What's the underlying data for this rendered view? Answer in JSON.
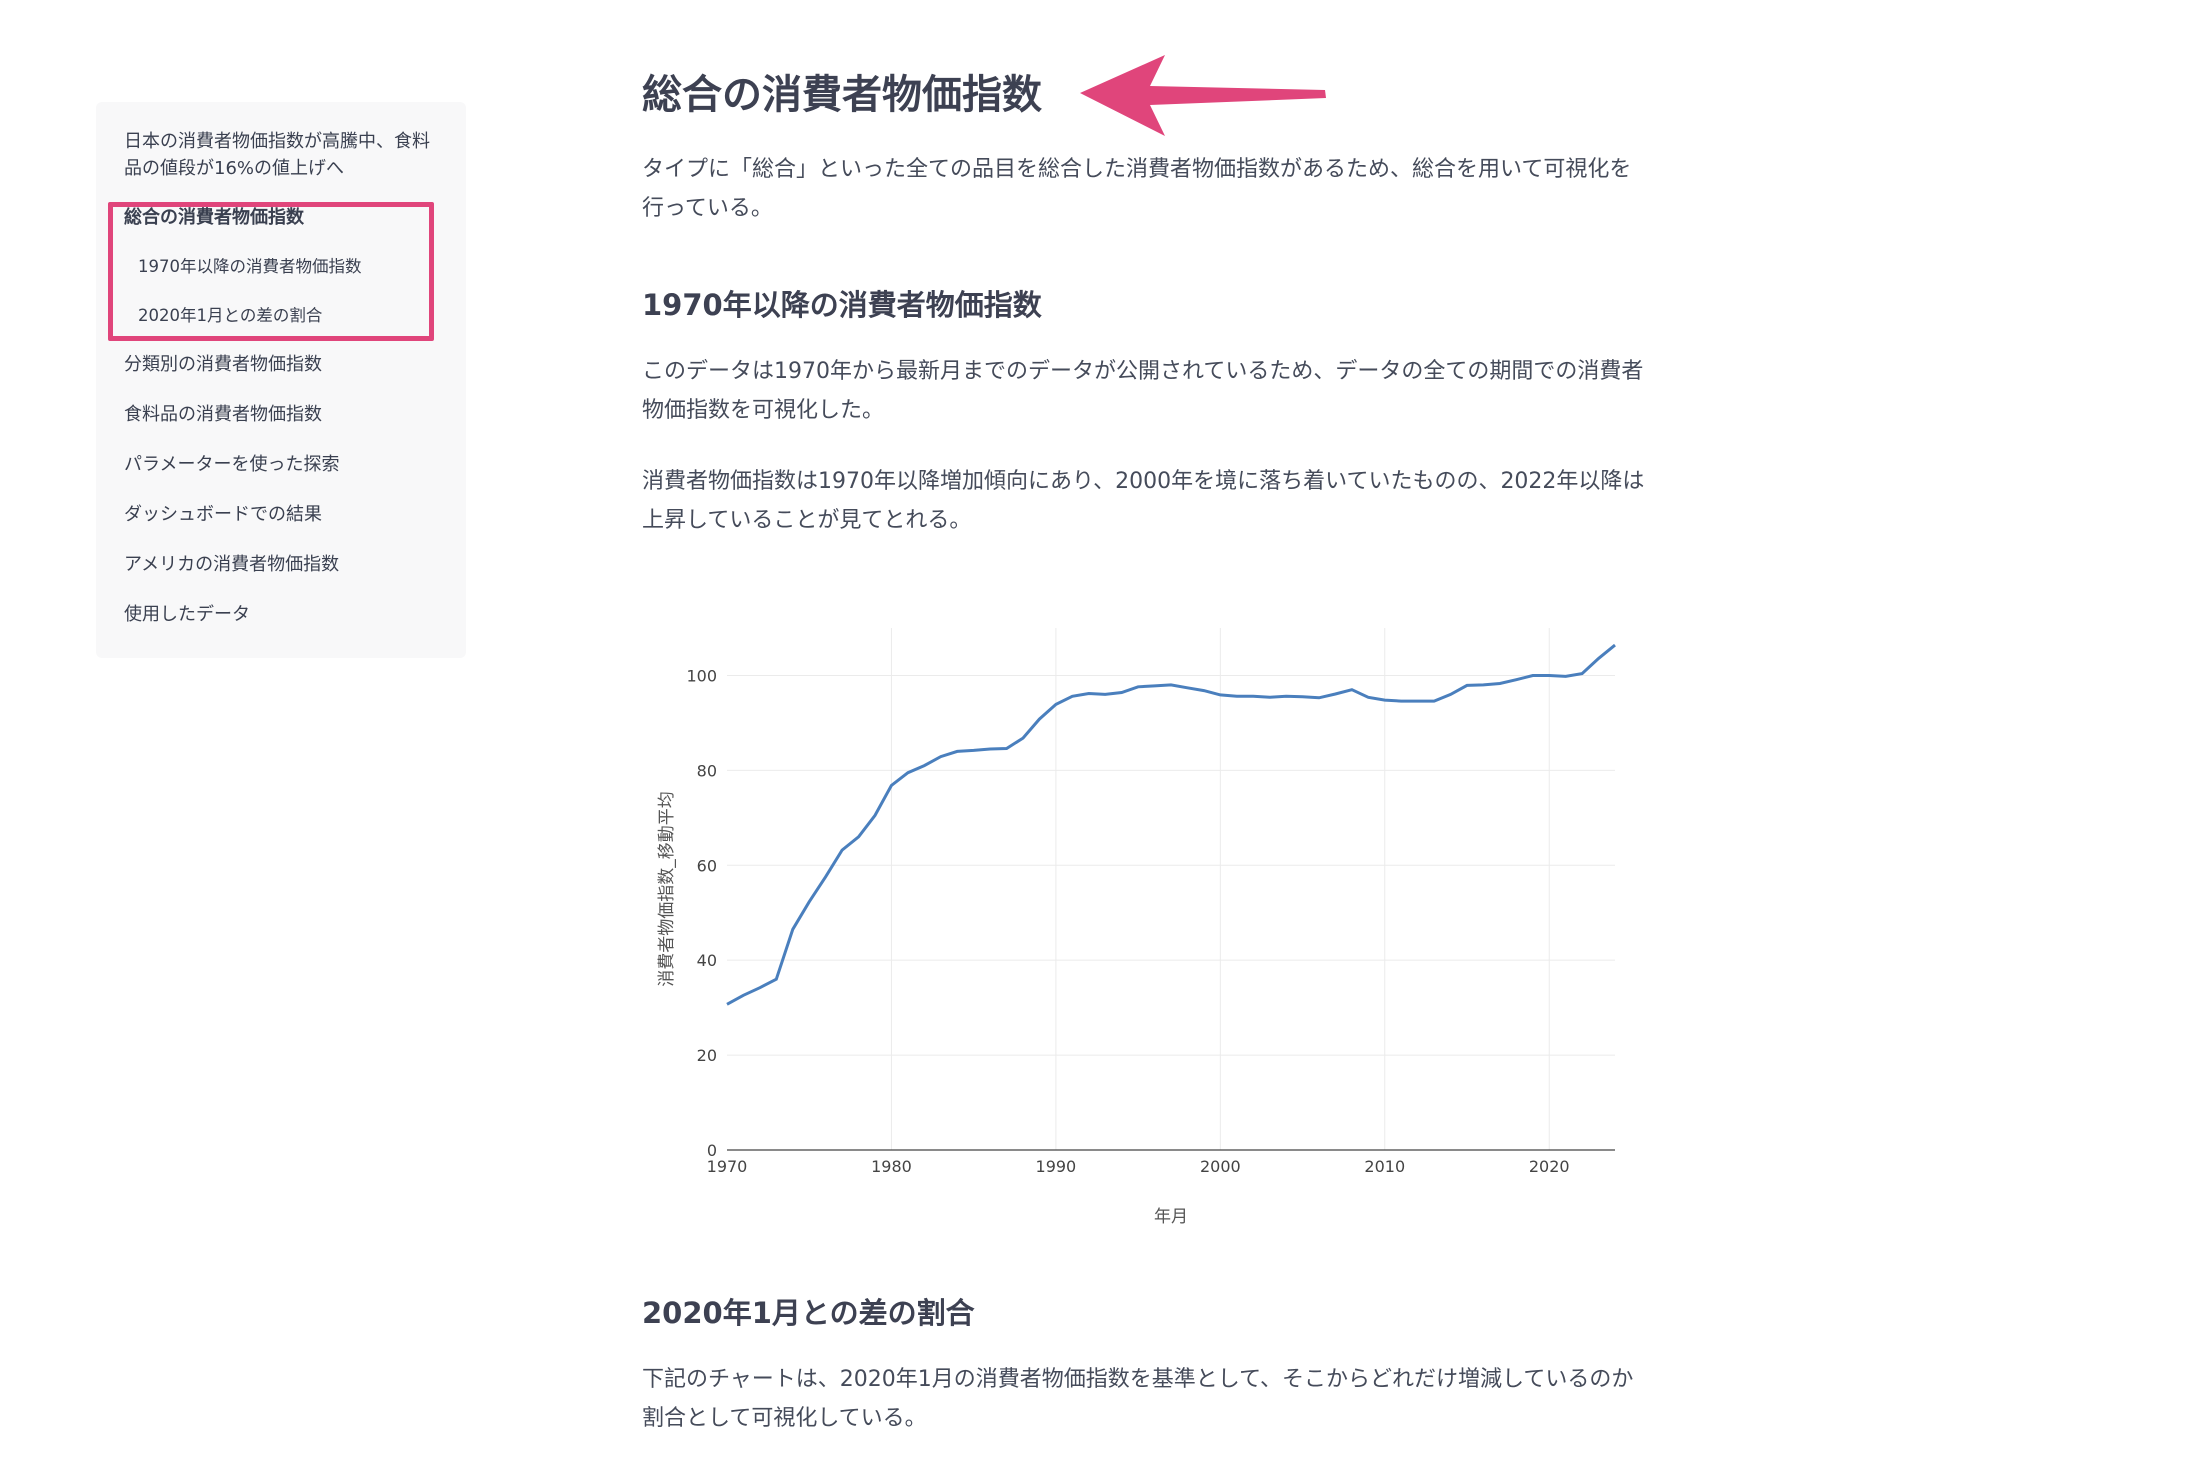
{
  "sidebar": {
    "items": [
      {
        "label": "日本の消費者物価指数が高騰中、食料品の値段が16%の値上げへ"
      },
      {
        "label": "総合の消費者物価指数"
      },
      {
        "label": "1970年以降の消費者物価指数"
      },
      {
        "label": "2020年1月との差の割合"
      },
      {
        "label": "分類別の消費者物価指数"
      },
      {
        "label": "食料品の消費者物価指数"
      },
      {
        "label": "パラメーターを使った探索"
      },
      {
        "label": "ダッシュボードでの結果"
      },
      {
        "label": "アメリカの消費者物価指数"
      },
      {
        "label": "使用したデータ"
      }
    ],
    "active_item": "総合の消費者物価指数"
  },
  "highlight_color": "#e0457b",
  "article": {
    "title": "総合の消費者物価指数",
    "intro": "タイプに「総合」といった全ての品目を総合した消費者物価指数があるため、総合を用いて可視化を行っている。",
    "section1": {
      "heading": "1970年以降の消費者物価指数",
      "p1": "このデータは1970年から最新月までのデータが公開されているため、データの全ての期間での消費者物価指数を可視化した。",
      "p2": "消費者物価指数は1970年以降増加傾向にあり、2000年を境に落ち着いていたものの、2022年以降は上昇していることが見てとれる。"
    },
    "section2": {
      "heading": "2020年1月との差の割合",
      "p1": "下記のチャートは、2020年1月の消費者物価指数を基準として、そこからどれだけ増減しているのか割合として可視化している。"
    }
  },
  "chart_data": {
    "type": "line",
    "xlabel": "年月",
    "ylabel": "消費者物価指数_移動平均",
    "xlim": [
      1970,
      2024
    ],
    "ylim": [
      0,
      110
    ],
    "x_ticks": [
      1970,
      1980,
      1990,
      2000,
      2010,
      2020
    ],
    "y_ticks": [
      0,
      20,
      40,
      60,
      80,
      100
    ],
    "grid": true,
    "line_color": "#4a7fbd",
    "series": [
      {
        "x": [
          1970,
          1971,
          1972,
          1973,
          1974,
          1975,
          1976,
          1977,
          1978,
          1979,
          1980,
          1981,
          1982,
          1983,
          1984,
          1985,
          1986,
          1987,
          1988,
          1989,
          1990,
          1991,
          1992,
          1993,
          1994,
          1995,
          1996,
          1997,
          1998,
          1999,
          2000,
          2001,
          2002,
          2003,
          2004,
          2005,
          2006,
          2007,
          2008,
          2009,
          2010,
          2011,
          2012,
          2013,
          2014,
          2015,
          2016,
          2017,
          2018,
          2019,
          2020,
          2021,
          2022,
          2023,
          2024
        ],
        "y": [
          30.7,
          32.6,
          34.2,
          36.0,
          46.5,
          52.3,
          57.6,
          63.2,
          66.0,
          70.5,
          76.8,
          79.5,
          81.0,
          82.9,
          84.0,
          84.2,
          84.5,
          84.6,
          86.8,
          90.8,
          93.9,
          95.6,
          96.2,
          96.0,
          96.4,
          97.6,
          97.8,
          98.0,
          97.4,
          96.8,
          95.9,
          95.6,
          95.6,
          95.4,
          95.6,
          95.5,
          95.3,
          96.1,
          97.0,
          95.4,
          94.8,
          94.6,
          94.6,
          94.6,
          96.0,
          97.9,
          98.0,
          98.3,
          99.1,
          100.0,
          100.0,
          99.8,
          100.4,
          103.6,
          106.4
        ]
      }
    ]
  }
}
